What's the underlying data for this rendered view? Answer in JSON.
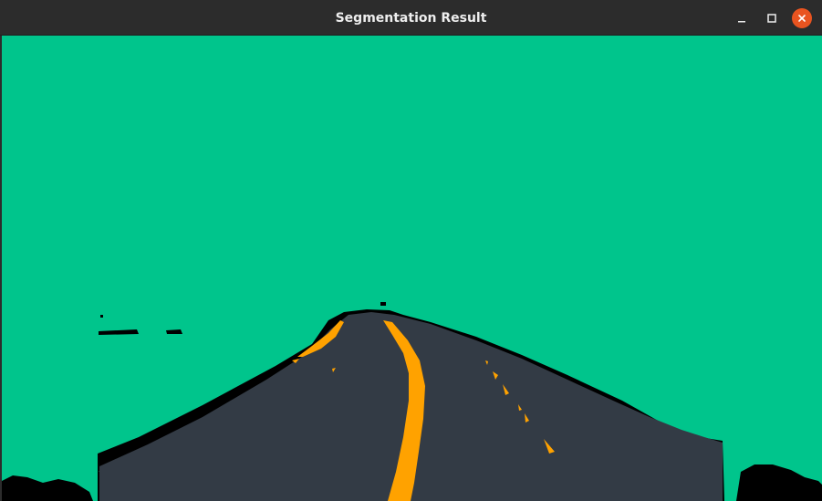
{
  "window": {
    "title": "Segmentation Result",
    "controls": {
      "minimize_icon": "minimize-icon",
      "maximize_icon": "maximize-icon",
      "close_icon": "close-icon"
    }
  },
  "segmentation": {
    "classes": [
      {
        "color": "#00c58c"
      },
      {
        "color": "#333b45"
      },
      {
        "color": "#ffa200"
      },
      {
        "color": "#000000"
      }
    ]
  },
  "colors": {
    "titlebar": "#2c2c2c",
    "close_accent": "#e95420"
  }
}
